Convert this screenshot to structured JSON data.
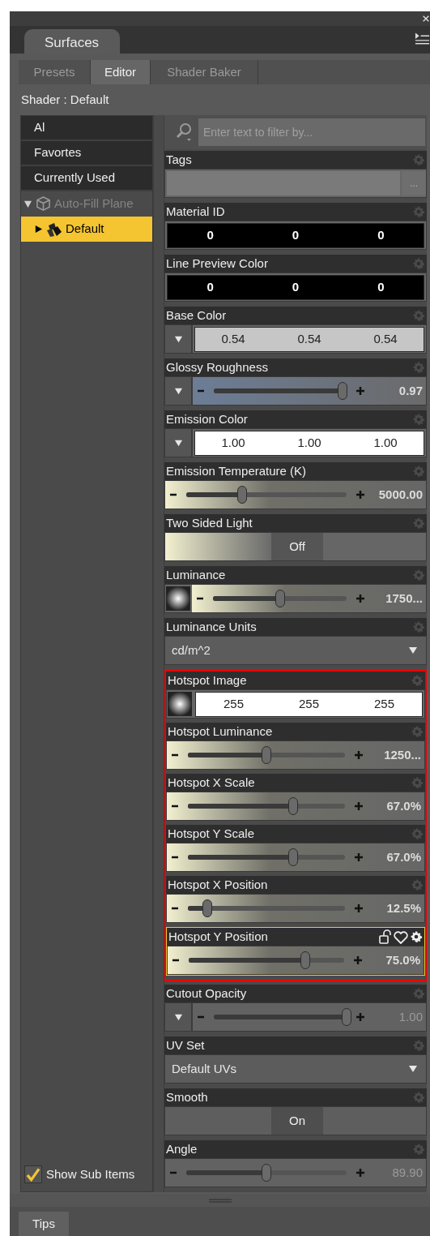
{
  "window": {
    "tab": "Surfaces"
  },
  "tabs": [
    {
      "label": "Presets",
      "selected": false
    },
    {
      "label": "Editor",
      "selected": true
    },
    {
      "label": "Shader Baker",
      "selected": false
    }
  ],
  "shader_label": "Shader : Default",
  "sidebar": {
    "items": [
      {
        "label": "Al",
        "selected": false
      },
      {
        "label": "Favortes",
        "selected": false
      },
      {
        "label": "Currently Used",
        "selected": false
      }
    ],
    "tree": [
      {
        "label": "Auto-Fill Plane",
        "expanded": true,
        "disabled": true,
        "selected": false,
        "children": [
          {
            "label": "Default",
            "expanded": false,
            "disabled": false,
            "selected": true
          }
        ]
      }
    ],
    "show_sub_items": {
      "label": "Show Sub Items",
      "checked": true
    }
  },
  "filter": {
    "placeholder": "Enter text to filter by..."
  },
  "properties": [
    {
      "label": "Tags",
      "kind": "tags",
      "button": "...",
      "selected": false,
      "highlighted": false
    },
    {
      "label": "Material ID",
      "kind": "color",
      "color": "#000000",
      "values": [
        "0",
        "0",
        "0"
      ],
      "selected": false,
      "highlighted": false
    },
    {
      "label": "Line Preview Color",
      "kind": "color",
      "color": "#000000",
      "values": [
        "0",
        "0",
        "0"
      ],
      "selected": false,
      "highlighted": false
    },
    {
      "label": "Base Color",
      "kind": "color",
      "prefix": {
        "kind": "menu"
      },
      "color": "#c6c6c6",
      "values": [
        "0.54",
        "0.54",
        "0.54"
      ],
      "selected": false,
      "highlighted": false
    },
    {
      "label": "Glossy Roughness",
      "kind": "slider",
      "prefix": {
        "kind": "menu"
      },
      "level": 0.97,
      "value": "0.97",
      "disabled": false,
      "selected": false,
      "highlighted": false
    },
    {
      "label": "Emission Color",
      "kind": "color",
      "prefix": {
        "kind": "menu"
      },
      "color": "#ffffff",
      "values": [
        "1.00",
        "1.00",
        "1.00"
      ],
      "selected": false,
      "highlighted": false
    },
    {
      "label": "Emission Temperature (K)",
      "kind": "slider",
      "level": 0.35,
      "value": "5000.00",
      "disabled": false,
      "selected": false,
      "highlighted": false
    },
    {
      "label": "Two Sided Light",
      "kind": "toggle",
      "value": "Off",
      "on": false,
      "selected": false,
      "highlighted": false
    },
    {
      "label": "Luminance",
      "kind": "slider",
      "prefix": {
        "kind": "image"
      },
      "level": 0.5,
      "value": "1750...",
      "disabled": false,
      "selected": false,
      "highlighted": false
    },
    {
      "label": "Luminance Units",
      "kind": "dropdown",
      "value": "cd/m^2",
      "selected": false,
      "highlighted": false
    },
    {
      "label": "Hotspot Image",
      "kind": "color",
      "prefix": {
        "kind": "image"
      },
      "color": "#ffffff",
      "values": [
        "255",
        "255",
        "255"
      ],
      "selected": false,
      "highlighted": true
    },
    {
      "label": "Hotspot Luminance",
      "kind": "slider",
      "level": 0.5,
      "value": "1250...",
      "disabled": false,
      "selected": false,
      "highlighted": true
    },
    {
      "label": "Hotspot X Scale",
      "kind": "slider",
      "level": 0.67,
      "value": "67.0%",
      "disabled": false,
      "selected": false,
      "highlighted": true
    },
    {
      "label": "Hotspot Y Scale",
      "kind": "slider",
      "level": 0.67,
      "value": "67.0%",
      "disabled": false,
      "selected": false,
      "highlighted": true
    },
    {
      "label": "Hotspot X Position",
      "kind": "slider",
      "level": 0.125,
      "value": "12.5%",
      "disabled": false,
      "selected": false,
      "highlighted": true
    },
    {
      "label": "Hotspot Y Position",
      "kind": "slider",
      "level": 0.75,
      "value": "75.0%",
      "disabled": false,
      "selected": true,
      "highlighted": true
    },
    {
      "label": "Cutout Opacity",
      "kind": "slider",
      "prefix": {
        "kind": "menu"
      },
      "level": 1,
      "value": "1.00",
      "disabled": true,
      "selected": false,
      "highlighted": false
    },
    {
      "label": "UV Set",
      "kind": "dropdown",
      "value": "Default UVs",
      "selected": false,
      "highlighted": false
    },
    {
      "label": "Smooth",
      "kind": "toggle",
      "value": "On",
      "on": true,
      "selected": false,
      "highlighted": false
    },
    {
      "label": "Angle",
      "kind": "slider",
      "level": 0.5,
      "value": "89.90",
      "disabled": true,
      "selected": false,
      "highlighted": false
    }
  ],
  "footer_tab": "Tips"
}
